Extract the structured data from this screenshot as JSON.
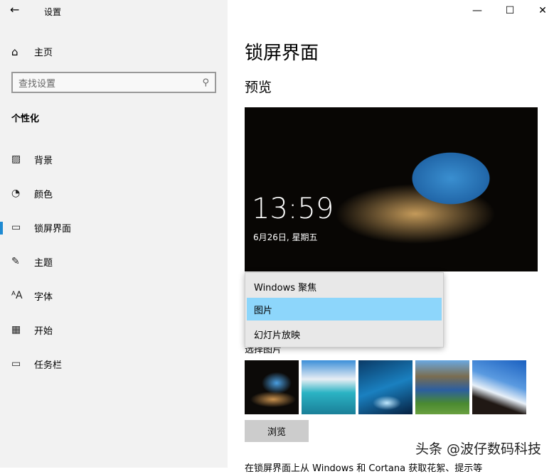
{
  "app": {
    "title": "设置"
  },
  "sidebar": {
    "home": "主页",
    "search_placeholder": "查找设置",
    "section": "个性化",
    "items": [
      {
        "label": "背景",
        "icon": "picture-icon"
      },
      {
        "label": "颜色",
        "icon": "palette-icon"
      },
      {
        "label": "锁屏界面",
        "icon": "lock-screen-icon"
      },
      {
        "label": "主题",
        "icon": "theme-icon"
      },
      {
        "label": "字体",
        "icon": "font-icon"
      },
      {
        "label": "开始",
        "icon": "start-icon"
      },
      {
        "label": "任务栏",
        "icon": "taskbar-icon"
      }
    ]
  },
  "main": {
    "title": "锁屏界面",
    "preview_label": "预览",
    "time": "13:59",
    "date": "6月26日, 星期五",
    "dropdown": [
      "Windows 聚焦",
      "图片",
      "幻灯片放映"
    ],
    "choose_label": "选择图片",
    "browse": "浏览",
    "bottom_text": "在锁屏界面上从 Windows 和 Cortana 获取花絮、提示等"
  },
  "watermark": "头条 @波仔数码科技"
}
